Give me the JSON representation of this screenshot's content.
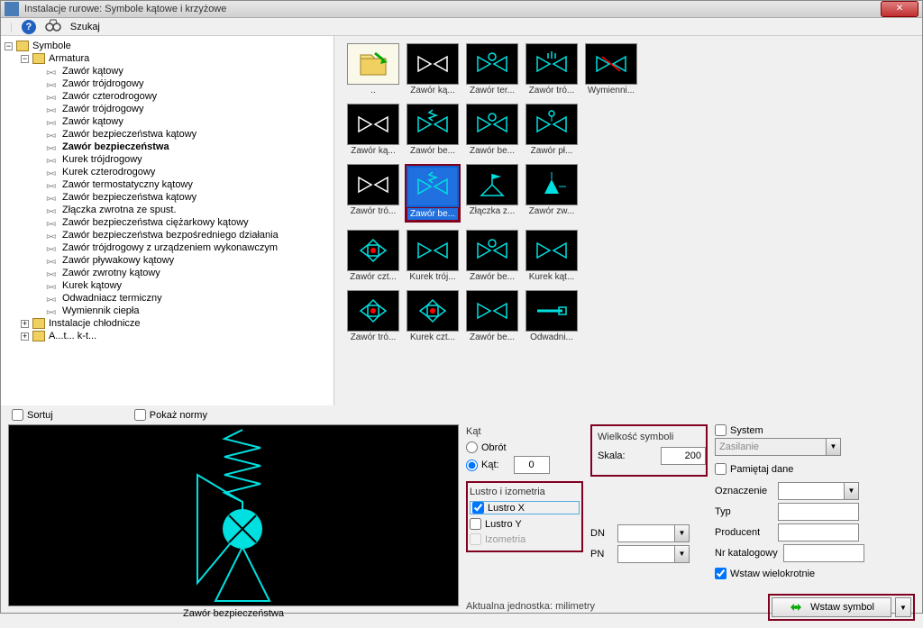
{
  "titlebar": {
    "text": "Instalacje rurowe: Symbole kątowe i krzyżowe"
  },
  "toolbar": {
    "help_icon": "?",
    "search_label": "Szukaj"
  },
  "tree": {
    "root": "Symbole",
    "armatura": "Armatura",
    "items": [
      "Zawór kątowy",
      "Zawór trójdrogowy",
      "Zawór czterodrogowy",
      "Zawór trójdrogowy",
      "Zawór kątowy",
      "Zawór bezpieczeństwa kątowy",
      "Zawór bezpieczeństwa",
      "Kurek trójdrogowy",
      "Kurek czterodrogowy",
      "Zawór termostatyczny kątowy",
      "Zawór bezpieczeństwa kątowy",
      "Złączka zwrotna ze spust.",
      "Zawór bezpieczeństwa ciężarkowy kątowy",
      "Zawór bezpieczeństwa bezpośredniego działania",
      "Zawór trójdrogowy z urządzeniem wykonawczym",
      "Zawór pływakowy kątowy",
      "Zawór zwrotny kątowy",
      "Kurek kątowy",
      "Odwadniacz termiczny",
      "Wymiennik ciepła"
    ],
    "chlodnicze": "Instalacje chłodnicze",
    "extra": "A...t... k-t..."
  },
  "sort": {
    "sortuj": "Sortuj",
    "pokaz_normy": "Pokaż normy"
  },
  "symbols": {
    "row1": [
      "..",
      "Zawór ką...",
      "Zawór ter...",
      "Zawór tró...",
      "Wymienni..."
    ],
    "row2": [
      "Zawór ką...",
      "Zawór be...",
      "Zawór be...",
      "Zawór pł..."
    ],
    "row3": [
      "Zawór tró...",
      "Zawór be...",
      "Złączka z...",
      "Zawór zw..."
    ],
    "row4": [
      "Zawór czt...",
      "Kurek trój...",
      "Zawór be...",
      "Kurek kąt..."
    ],
    "row5": [
      "Zawór tró...",
      "Kurek czt...",
      "Zawór be...",
      "Odwadni..."
    ]
  },
  "preview_label": "Zawór bezpieczeństwa",
  "kat": {
    "title": "Kąt",
    "obrot": "Obrót",
    "kat_label": "Kąt:",
    "kat_value": "0"
  },
  "lustro": {
    "title": "Lustro i izometria",
    "lx": "Lustro X",
    "ly": "Lustro Y",
    "izo": "Izometria"
  },
  "wielkosc": {
    "title": "Wielkość symboli",
    "skala": "Skala:",
    "skala_value": "200"
  },
  "params": {
    "dn": "DN",
    "pn": "PN"
  },
  "right": {
    "system": "System",
    "system_value": "Zasilanie",
    "pamietaj": "Pamiętaj dane",
    "oznaczenie": "Oznaczenie",
    "typ": "Typ",
    "producent": "Producent",
    "nrkat": "Nr katalogowy",
    "wstaw_wiele": "Wstaw wielokrotnie"
  },
  "unit_label": "Aktualna jednostka: milimetry",
  "insert_btn": "Wstaw symbol"
}
